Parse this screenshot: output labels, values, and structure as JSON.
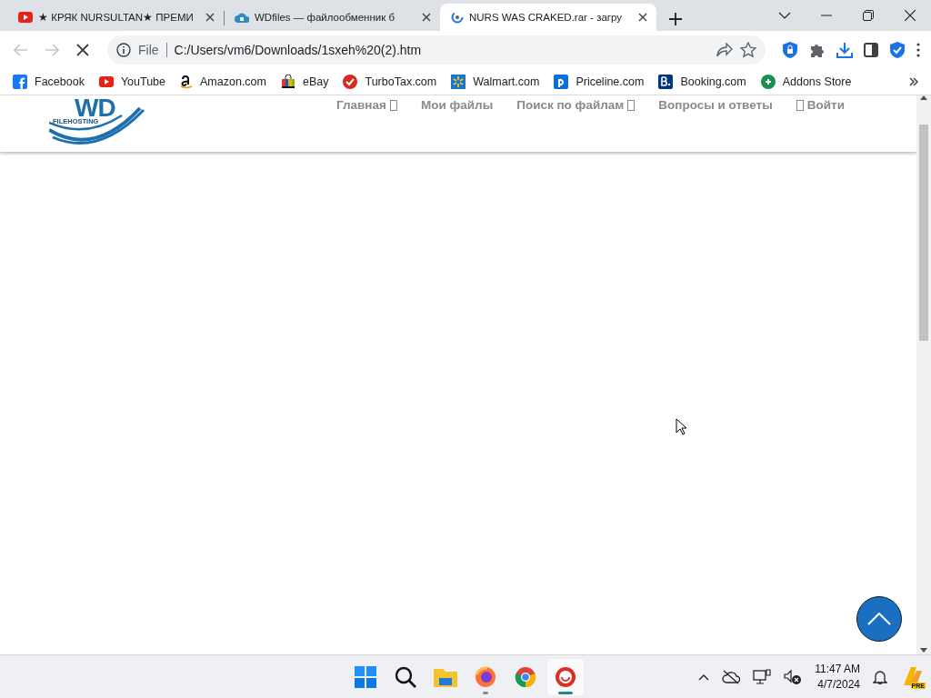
{
  "tabs": [
    {
      "title": "★ КРЯК NURSULTAN★ ПРЕМИ",
      "kind": "video",
      "selected": false
    },
    {
      "title": "WDfiles — файлообменник б",
      "kind": "cloud",
      "selected": false
    },
    {
      "title": "NURS WAS CRAKED.rar - загру",
      "kind": "loading",
      "selected": true
    }
  ],
  "address_bar": {
    "scheme": "File",
    "url": "C:/Users/vm6/Downloads/1sxeh%20(2).htm"
  },
  "bookmarks": [
    {
      "label": "Facebook",
      "kind": "facebook"
    },
    {
      "label": "YouTube",
      "kind": "youtube"
    },
    {
      "label": "Amazon.com",
      "kind": "amazon"
    },
    {
      "label": "eBay",
      "kind": "ebay"
    },
    {
      "label": "TurboTax.com",
      "kind": "turbotax"
    },
    {
      "label": "Walmart.com",
      "kind": "walmart"
    },
    {
      "label": "Priceline.com",
      "kind": "priceline"
    },
    {
      "label": "Booking.com",
      "kind": "booking"
    },
    {
      "label": "Addons Store",
      "kind": "addons"
    }
  ],
  "site": {
    "logo_text": "WD",
    "logo_subtitle": "FILEHOSTING",
    "nav": [
      {
        "label": "Главная",
        "glyph_before": false,
        "glyph_after": true
      },
      {
        "label": "Мои файлы",
        "glyph_before": false,
        "glyph_after": false
      },
      {
        "label": "Поиск по файлам",
        "glyph_before": false,
        "glyph_after": true
      },
      {
        "label": "Вопросы и ответы",
        "glyph_before": false,
        "glyph_after": false
      },
      {
        "label": "Войти",
        "glyph_before": true,
        "glyph_after": false
      }
    ]
  },
  "taskbar": {
    "apps": [
      {
        "kind": "start",
        "running": false,
        "selected": false
      },
      {
        "kind": "search",
        "running": false,
        "selected": false
      },
      {
        "kind": "explorer",
        "running": false,
        "selected": false
      },
      {
        "kind": "firefox",
        "running": true,
        "selected": false
      },
      {
        "kind": "chrome",
        "running": false,
        "selected": false
      },
      {
        "kind": "app",
        "running": true,
        "selected": true
      }
    ],
    "time": "11:47 AM",
    "date": "4/7/2024",
    "badge": "PRE"
  }
}
